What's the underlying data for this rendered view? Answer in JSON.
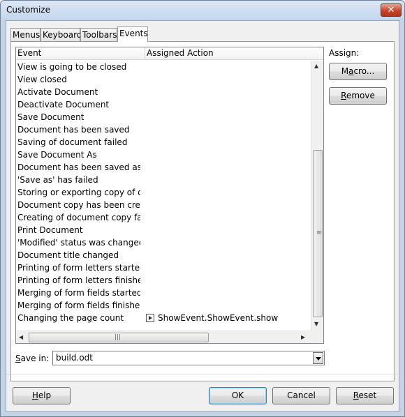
{
  "window": {
    "title": "Customize",
    "close_glyph": "✕"
  },
  "tabs": [
    {
      "label": "Menus",
      "active": false
    },
    {
      "label": "Keyboard",
      "active": false
    },
    {
      "label": "Toolbars",
      "active": false
    },
    {
      "label": "Events",
      "active": true
    }
  ],
  "list": {
    "columns": [
      "Event",
      "Assigned Action"
    ],
    "rows": [
      {
        "event": "View is going to be closed",
        "action": ""
      },
      {
        "event": "View closed",
        "action": ""
      },
      {
        "event": "Activate Document",
        "action": ""
      },
      {
        "event": "Deactivate Document",
        "action": ""
      },
      {
        "event": "Save Document",
        "action": ""
      },
      {
        "event": "Document has been saved",
        "action": ""
      },
      {
        "event": "Saving of document failed",
        "action": ""
      },
      {
        "event": "Save Document As",
        "action": ""
      },
      {
        "event": "Document has been saved as",
        "action": ""
      },
      {
        "event": "'Save as' has failed",
        "action": ""
      },
      {
        "event": "Storing or exporting copy of docu",
        "action": ""
      },
      {
        "event": "Document copy has been created",
        "action": ""
      },
      {
        "event": "Creating of document copy failed",
        "action": ""
      },
      {
        "event": "Print Document",
        "action": ""
      },
      {
        "event": "'Modified' status was changed",
        "action": ""
      },
      {
        "event": "Document title changed",
        "action": ""
      },
      {
        "event": "Printing of form letters started",
        "action": ""
      },
      {
        "event": "Printing of form letters finished",
        "action": ""
      },
      {
        "event": "Merging of form fields started",
        "action": ""
      },
      {
        "event": "Merging of form fields finished",
        "action": ""
      },
      {
        "event": "Changing the page count",
        "action": "ShowEvent.ShowEvent.show",
        "icon": "macro-icon"
      }
    ]
  },
  "assign": {
    "label": "Assign:",
    "macro_button": {
      "pre": "M",
      "ul": "a",
      "post": "cro..."
    },
    "remove_button": {
      "pre": "",
      "ul": "R",
      "post": "emove"
    }
  },
  "save_in": {
    "label_ul": "S",
    "label_rest": "ave in:",
    "value": "build.odt"
  },
  "footer": {
    "help": {
      "ul": "H",
      "post": "elp"
    },
    "ok": "OK",
    "cancel": "Cancel",
    "reset": {
      "pre": "",
      "ul": "R",
      "post": "eset"
    }
  },
  "colors": {
    "frame": "#c4d3e6",
    "close": "#c7432a",
    "default_button": "#3c7fb1"
  }
}
